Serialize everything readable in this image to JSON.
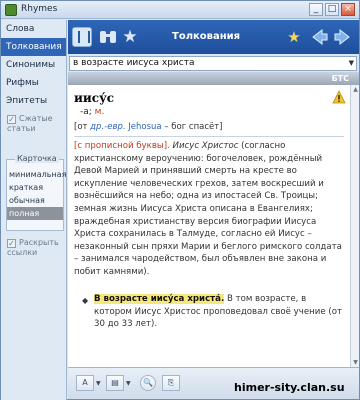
{
  "window": {
    "title": "Rhymes",
    "minimize_label": "_",
    "maximize_label": "□",
    "close_label": "×"
  },
  "sidebar": {
    "items": [
      {
        "label": "Слова"
      },
      {
        "label": "Толкования"
      },
      {
        "label": "Синонимы"
      },
      {
        "label": "Рифмы"
      },
      {
        "label": "Эпитеты"
      }
    ],
    "active_index": 1,
    "option_short_articles": "Сжатые статьи",
    "card_group_label": "Карточка",
    "card_options": [
      {
        "label": "минимальная"
      },
      {
        "label": "краткая"
      },
      {
        "label": "обычная"
      },
      {
        "label": "полная"
      }
    ],
    "card_active_index": 3,
    "option_expand_links": "Раскрыть ссылки",
    "check_mark": "✓"
  },
  "toolbar": {
    "title": "Толкования",
    "icons": [
      "dictionary-icon",
      "binoculars-icon",
      "star-icon",
      "add-favorite-icon",
      "back-arrow-icon",
      "forward-arrow-icon"
    ],
    "star_glyph": "★",
    "addfav_glyph": "★"
  },
  "search": {
    "value": "в возрасте иисуса христа",
    "dropdown_glyph": "▼"
  },
  "dictionary": {
    "code": "БТС"
  },
  "article": {
    "headword": "иису́с",
    "grammar": "-а;",
    "gender": "м.",
    "etym_open": "[от",
    "etym_lang": "др.-евр.",
    "etym_word": "Jehosua",
    "etym_gloss": "– бог спасёт]",
    "def_note": "[с прописной буквы].",
    "def_lemma": "Иисус Христос",
    "def_text": "(согласно христианскому вероучению: богочеловек, рождённый Девой Марией и принявший смерть на кресте во искупление человеческих грехов, затем воскресший и вознёсшийся на небо; одна из ипостасей Св. Троицы; земная жизнь Иисуса Христа описана в Евангелиях; враждебная христианству версия биографии Иисуса Христа сохранилась в Талмуде, согласно ей Иисус – незаконный сын пряхи Марии и беглого римского солдата – занимался чародейством, был объявлен вне закона и побит камнями).",
    "phrase_diamond": "◆",
    "phrase_head": "В возрасте иису́са христа́.",
    "phrase_text": "В том возрасте, в котором Иисус Христос проповедовал своё учение (от 30 до 33 лет)."
  },
  "scroll": {
    "up": "▲",
    "down": "▼"
  },
  "bottom": {
    "font_label": "A",
    "print_label": "▤",
    "zoom_label": "🔍",
    "copy_label": "⎘",
    "drop_glyph": "▼"
  },
  "watermark": "himer-sity.clan.su",
  "colors": {
    "accent": "#2f66b8",
    "highlight": "#f5e77a",
    "warning": "#f2c230"
  }
}
